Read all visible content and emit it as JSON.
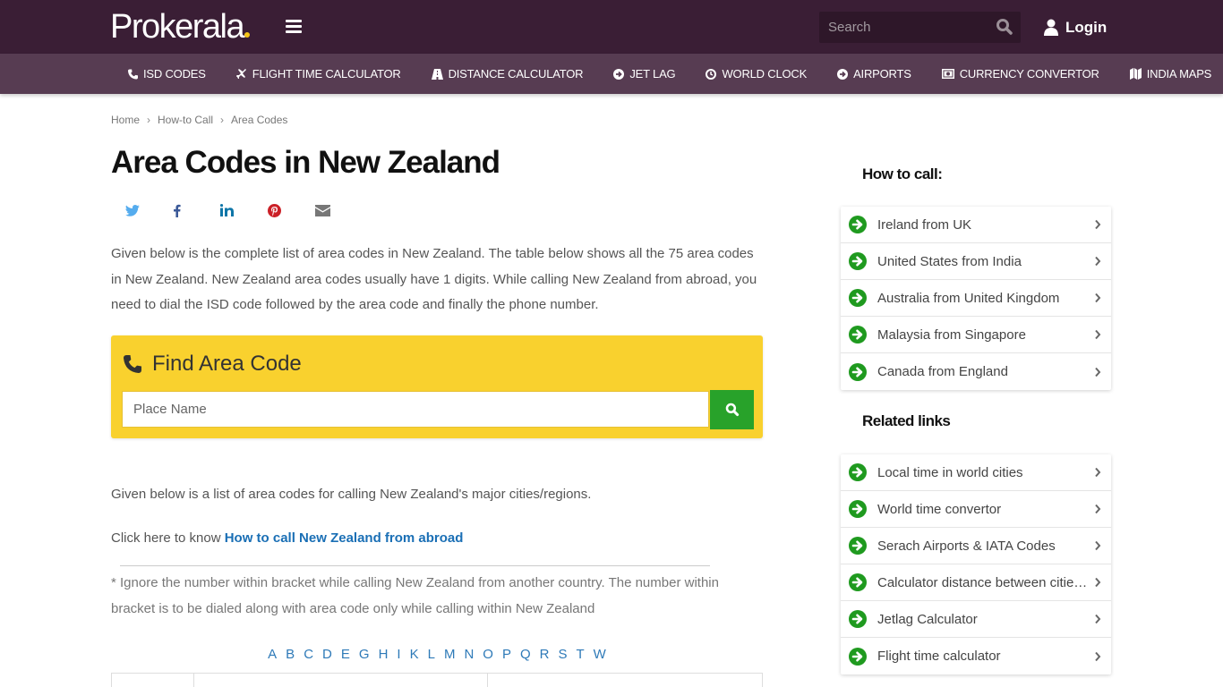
{
  "header": {
    "logo_text": "Prokerala",
    "search_placeholder": "Search",
    "login_label": "Login"
  },
  "nav": {
    "items": [
      {
        "label": "ISD CODES",
        "icon": "phone-icon"
      },
      {
        "label": "FLIGHT TIME CALCULATOR",
        "icon": "plane-icon"
      },
      {
        "label": "DISTANCE CALCULATOR",
        "icon": "road-icon"
      },
      {
        "label": "JET LAG",
        "icon": "arrow-circle-icon"
      },
      {
        "label": "WORLD CLOCK",
        "icon": "clock-icon"
      },
      {
        "label": "AIRPORTS",
        "icon": "arrow-circle-icon"
      },
      {
        "label": "CURRENCY CONVERTOR",
        "icon": "money-icon"
      },
      {
        "label": "INDIA MAPS",
        "icon": "map-icon"
      }
    ]
  },
  "breadcrumb": {
    "items": [
      "Home",
      "How-to Call",
      "Area Codes"
    ],
    "separator": "›"
  },
  "page": {
    "title": "Area Codes in New Zealand",
    "share": [
      "twitter",
      "facebook",
      "linkedin",
      "pinterest",
      "email"
    ],
    "intro": "Given below is the complete list of area codes in New Zealand. The table below shows all the 75 area codes in New Zealand. New Zealand area codes usually have 1 digits. While calling New Zealand from abroad, you need to dial the ISD code followed by the area code and finally the phone number.",
    "finder": {
      "title": "Find Area Code",
      "placeholder": "Place Name"
    },
    "list_intro": "Given below is a list of area codes for calling New Zealand's major cities/regions.",
    "click_prefix": "Click here to know ",
    "click_link": "How to call New Zealand from abroad",
    "note": "* Ignore the number within bracket while calling New Zealand from another country. The number within bracket is to be dialed along with area code only while calling within New Zealand",
    "alphabet": [
      "A",
      "B",
      "C",
      "D",
      "E",
      "G",
      "H",
      "I",
      "K",
      "L",
      "M",
      "N",
      "O",
      "P",
      "Q",
      "R",
      "S",
      "T",
      "W"
    ]
  },
  "sidebar": {
    "how_to_call": {
      "heading": "How to call:",
      "items": [
        "Ireland from UK",
        "United States from India",
        "Australia from United Kingdom",
        "Malaysia from Singapore",
        "Canada from England"
      ]
    },
    "related": {
      "heading": "Related links",
      "items": [
        "Local time in world cities",
        "World time convertor",
        "Serach Airports & IATA Codes",
        "Calculator distance between cities...",
        "Jetlag Calculator",
        "Flight time calculator"
      ]
    }
  },
  "colors": {
    "header_bg": "#3a1e35",
    "nav_bg": "#573c52",
    "finder_bg": "#f9d12e",
    "accent_green": "#28a22a",
    "link_blue": "#1a6fb5"
  }
}
